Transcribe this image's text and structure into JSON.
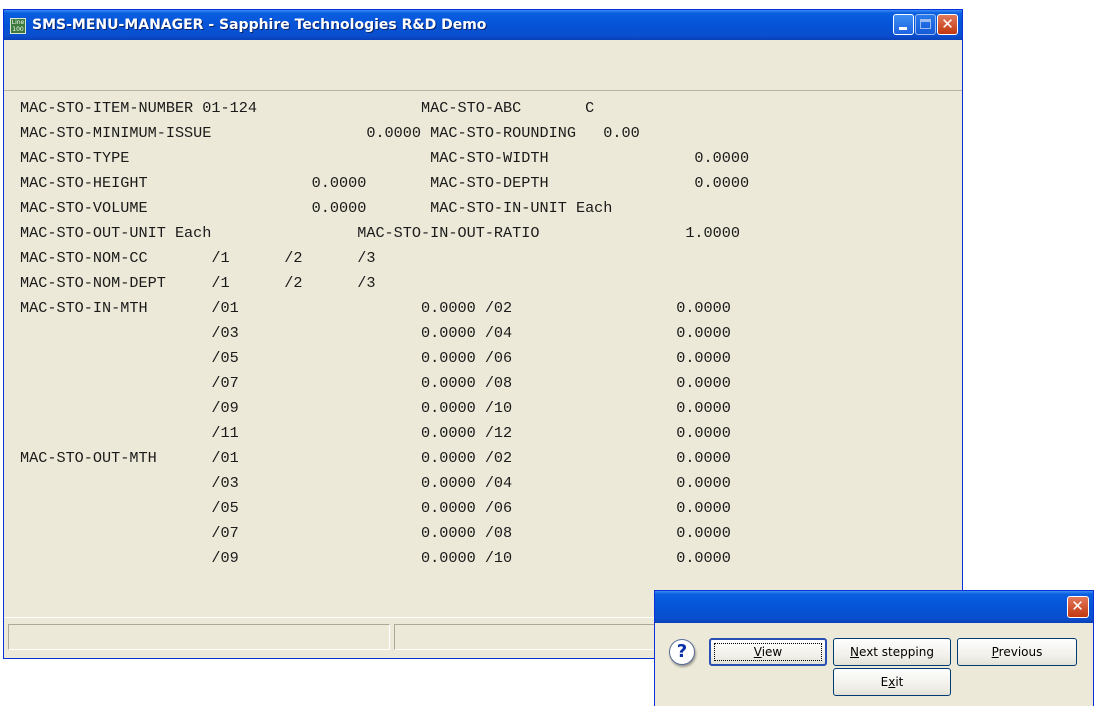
{
  "window": {
    "title": "SMS-MENU-MANAGER - Sapphire Technologies R&D Demo",
    "icon_text_line1": "Line",
    "icon_text_line2": "100"
  },
  "screen_lines": [
    "MAC-STO-ITEM-NUMBER 01-124                  MAC-STO-ABC       C",
    "MAC-STO-MINIMUM-ISSUE                 0.0000 MAC-STO-ROUNDING   0.00",
    "MAC-STO-TYPE                                 MAC-STO-WIDTH                0.0000",
    "MAC-STO-HEIGHT                  0.0000       MAC-STO-DEPTH                0.0000",
    "MAC-STO-VOLUME                  0.0000       MAC-STO-IN-UNIT Each",
    "MAC-STO-OUT-UNIT Each                MAC-STO-IN-OUT-RATIO                1.0000",
    "MAC-STO-NOM-CC       /1      /2      /3",
    "MAC-STO-NOM-DEPT     /1      /2      /3",
    "MAC-STO-IN-MTH       /01                    0.0000 /02                  0.0000",
    "                     /03                    0.0000 /04                  0.0000",
    "                     /05                    0.0000 /06                  0.0000",
    "                     /07                    0.0000 /08                  0.0000",
    "                     /09                    0.0000 /10                  0.0000",
    "                     /11                    0.0000 /12                  0.0000",
    "MAC-STO-OUT-MTH      /01                    0.0000 /02                  0.0000",
    "                     /03                    0.0000 /04                  0.0000",
    "                     /05                    0.0000 /06                  0.0000",
    "                     /07                    0.0000 /08                  0.0000",
    "                     /09                    0.0000 /10                  0.0000"
  ],
  "dialog": {
    "icon": "question-icon",
    "icon_glyph": "?",
    "close_glyph": "✕",
    "view_mnemonic": "V",
    "view_rest": "iew",
    "next_mnemonic": "N",
    "next_rest": "ext stepping",
    "previous_mnemonic": "P",
    "previous_rest": "revious",
    "exit_first": "E",
    "exit_mnemonic": "x",
    "exit_rest": "it"
  },
  "colors": {
    "titlebar": "#0553d6",
    "window_face": "#ece9d8",
    "close_button": "#c1370f"
  }
}
